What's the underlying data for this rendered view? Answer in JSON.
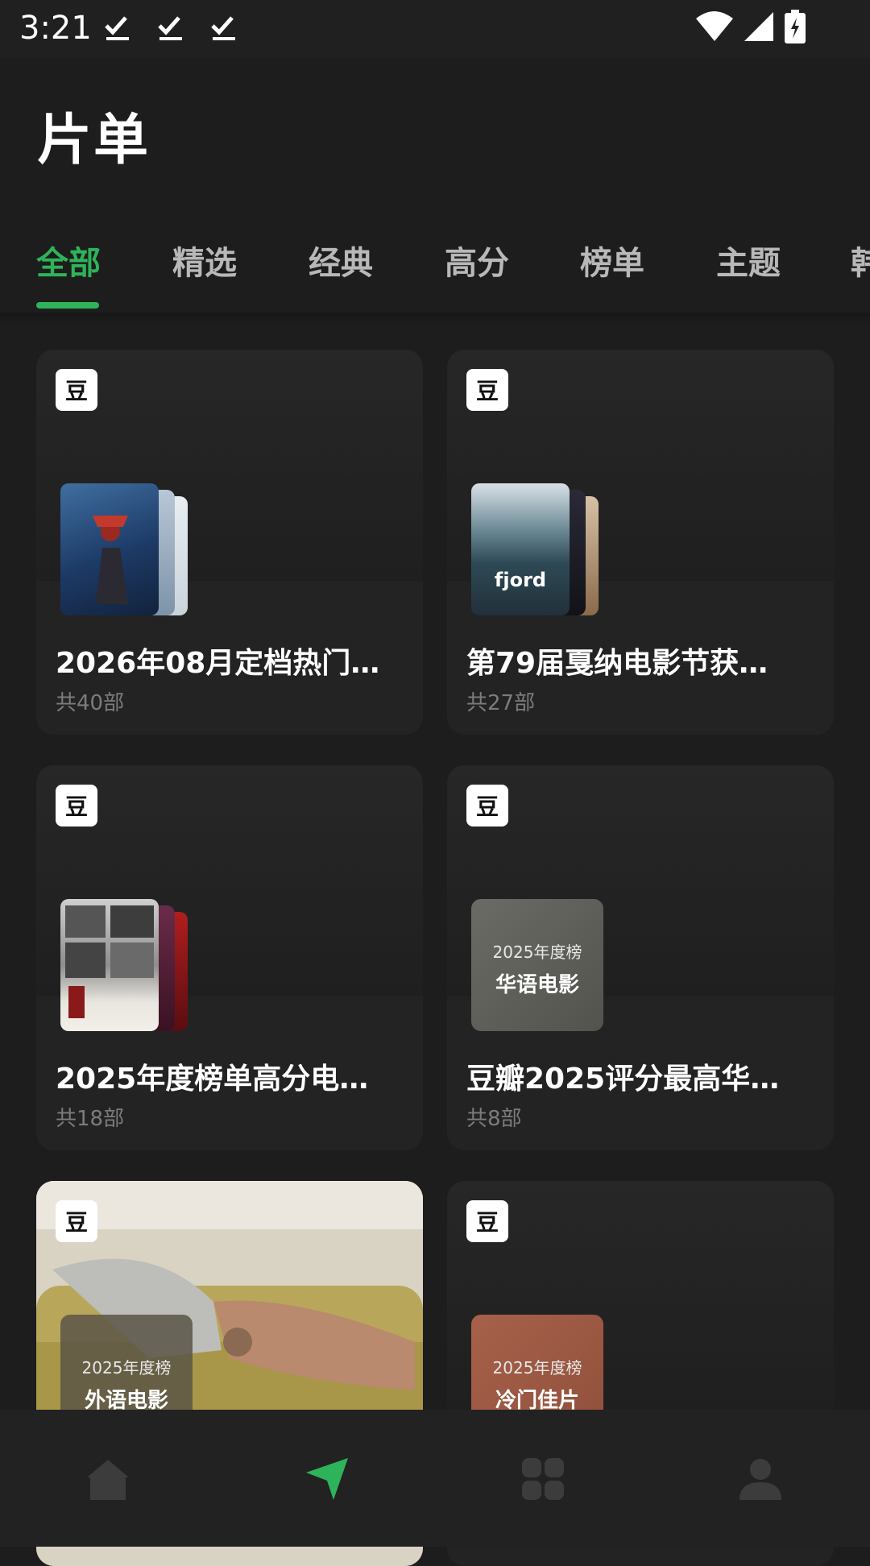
{
  "status_bar": {
    "time": "3:21"
  },
  "page": {
    "title": "片单"
  },
  "tabs": [
    {
      "label": "全部"
    },
    {
      "label": "精选"
    },
    {
      "label": "经典"
    },
    {
      "label": "高分"
    },
    {
      "label": "榜单"
    },
    {
      "label": "主题"
    },
    {
      "label": "韩"
    }
  ],
  "cards": [
    {
      "badge": "豆",
      "title": "2026年08月定档热门…",
      "count": "共40部",
      "poster_caption": ""
    },
    {
      "badge": "豆",
      "title": "第79届戛纳电影节获…",
      "count": "共27部",
      "poster_caption": "fjord"
    },
    {
      "badge": "豆",
      "title": "2025年度榜单高分电…",
      "count": "共18部",
      "poster_caption": ""
    },
    {
      "badge": "豆",
      "title": "豆瓣2025评分最高华…",
      "count": "共8部",
      "tile_line1": "2025年度榜",
      "tile_line2": "华语电影"
    },
    {
      "badge": "豆",
      "tile_line1": "2025年度榜",
      "tile_line2": "外语电影"
    },
    {
      "badge": "豆",
      "tile_line1": "2025年度榜",
      "tile_line2": "冷门佳片"
    }
  ],
  "colors": {
    "accent": "#2fb35a",
    "background": "#1d1d1d"
  },
  "bottom_nav": [
    {
      "icon": "home-icon"
    },
    {
      "icon": "discover-send-icon"
    },
    {
      "icon": "apps-grid-icon"
    },
    {
      "icon": "profile-icon"
    }
  ]
}
